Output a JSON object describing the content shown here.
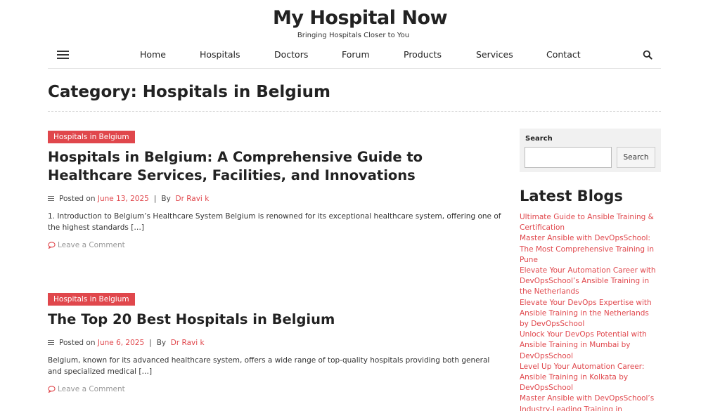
{
  "header": {
    "site_title": "My Hospital Now",
    "tagline": "Bringing Hospitals Closer to You"
  },
  "nav": {
    "items": [
      "Home",
      "Hospitals",
      "Doctors",
      "Forum",
      "Products",
      "Services",
      "Contact"
    ],
    "menu_icon": "hamburger-menu-icon",
    "search_icon": "search-icon"
  },
  "page": {
    "title": "Category: Hospitals in Belgium"
  },
  "posts": [
    {
      "category": "Hospitals in Belgium",
      "title": "Hospitals in Belgium: A Comprehensive Guide to Healthcare Services, Facilities, and Innovations",
      "posted_label": "Posted on",
      "date": "June 13, 2025",
      "by_label": "By",
      "author": "Dr Ravi k",
      "excerpt": "1. Introduction to Belgium’s Healthcare System Belgium is renowned for its exceptional healthcare system, offering one of the highest standards […]",
      "comment_label": "Leave a Comment"
    },
    {
      "category": "Hospitals in Belgium",
      "title": "The Top 20 Best Hospitals in Belgium",
      "posted_label": "Posted on",
      "date": "June 6, 2025",
      "by_label": "By",
      "author": "Dr Ravi k",
      "excerpt": "Belgium, known for its advanced healthcare system, offers a wide range of top-quality hospitals providing both general and specialized medical […]",
      "comment_label": "Leave a Comment"
    }
  ],
  "sidebar": {
    "search": {
      "label": "Search",
      "value": "",
      "button_label": "Search"
    },
    "latest_title": "Latest Blogs",
    "latest_posts": [
      "Ultimate Guide to Ansible Training & Certification",
      "Master Ansible with DevOpsSchool: The Most Comprehensive Training in Pune",
      "Elevate Your Automation Career with DevOpsSchool’s Ansible Training in the Netherlands",
      "Elevate Your DevOps Expertise with Ansible Training in the Netherlands by DevOpsSchool",
      "Unlock Your DevOps Potential with Ansible Training in Mumbai by DevOpsSchool",
      "Level Up Your Automation Career: Ansible Training in Kolkata by DevOpsSchool",
      "Master Ansible with DevOpsSchool’s Industry-Leading Training in"
    ]
  },
  "colors": {
    "accent": "#e0474c",
    "text": "#222222",
    "sidebar_bg": "#f1f1f1"
  }
}
